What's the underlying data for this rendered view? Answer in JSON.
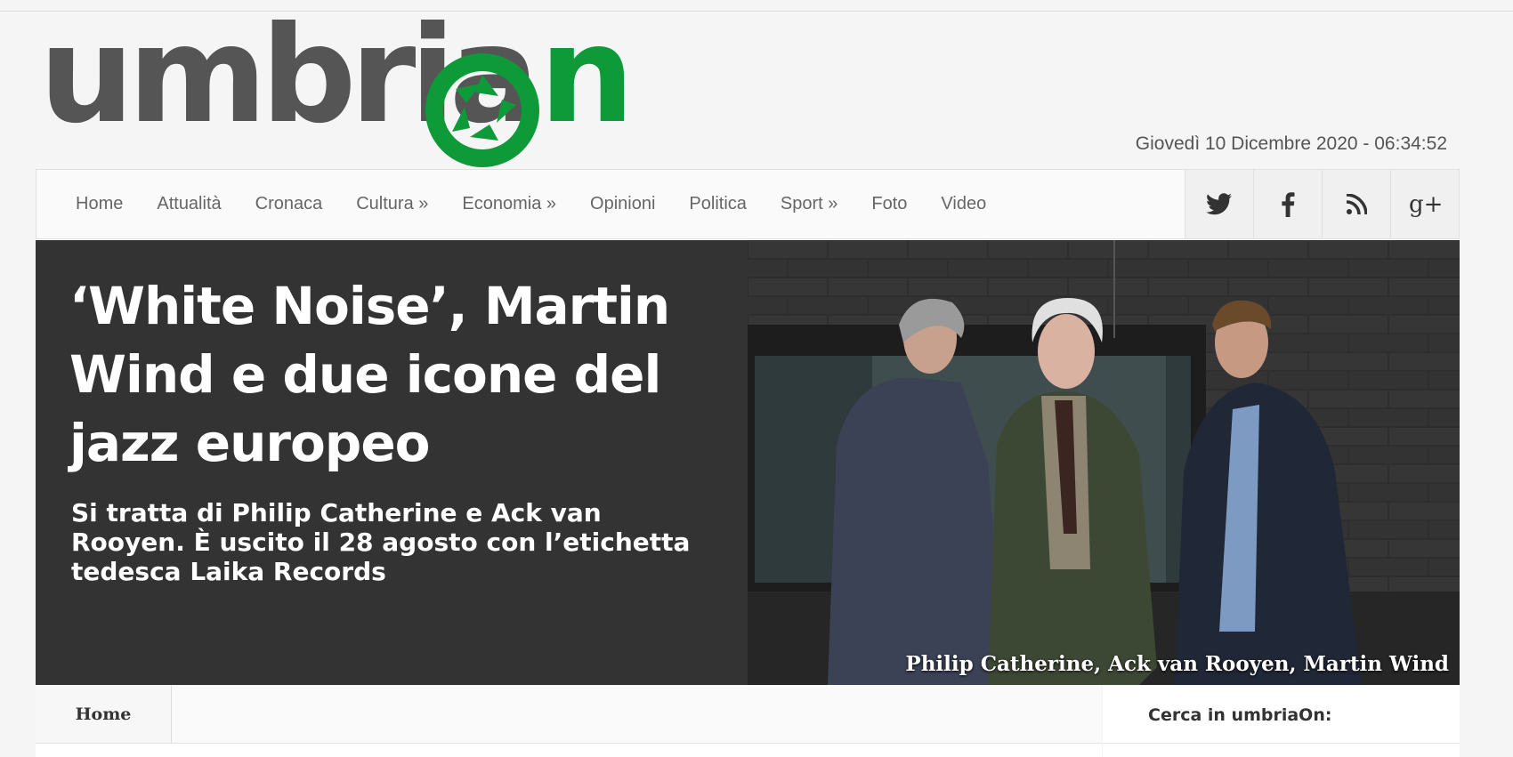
{
  "brand": {
    "logo_text_1": "umbria",
    "logo_text_2": "n",
    "logo_full": "umbriaOn",
    "accent_color": "#0f9a3a"
  },
  "header": {
    "datetime": "Giovedì 10 Dicembre 2020 - 06:34:52"
  },
  "nav": {
    "items": [
      {
        "label": "Home"
      },
      {
        "label": "Attualità"
      },
      {
        "label": "Cronaca"
      },
      {
        "label": "Cultura »"
      },
      {
        "label": "Economia »"
      },
      {
        "label": "Opinioni"
      },
      {
        "label": "Politica"
      },
      {
        "label": "Sport »"
      },
      {
        "label": "Foto"
      },
      {
        "label": "Video"
      }
    ],
    "social": [
      {
        "icon": "twitter-icon"
      },
      {
        "icon": "facebook-icon"
      },
      {
        "icon": "rss-icon"
      },
      {
        "icon": "google-plus-icon"
      }
    ]
  },
  "hero": {
    "headline": "‘White Noise’, Martin Wind e due icone del jazz europeo",
    "subheadline": "Si tratta di Philip Catherine e Ack van Rooyen. È uscito il 28 agosto con l’etichetta tedesca Laika Records",
    "photo_caption": "Philip Catherine, Ack van Rooyen, Martin Wind"
  },
  "breadcrumb": {
    "home_label": "Home"
  },
  "sidebar": {
    "search_label": "Cerca in umbriaOn:"
  }
}
